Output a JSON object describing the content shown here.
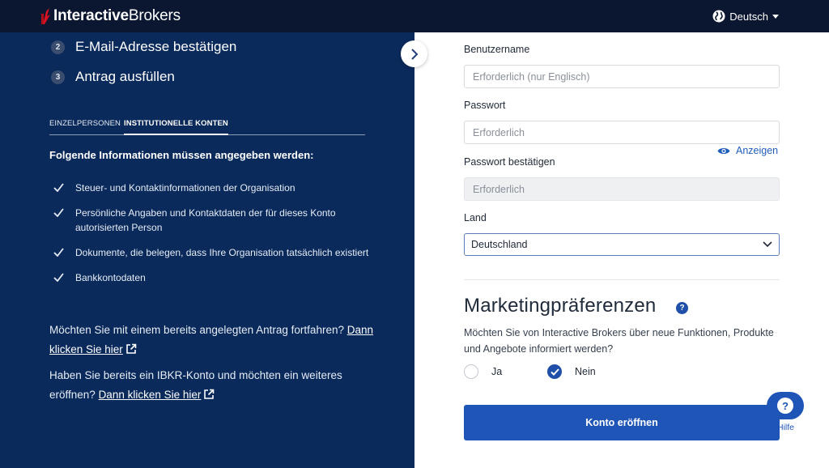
{
  "header": {
    "brand_bold": "Interactive",
    "brand_light": "Brokers",
    "language": "Deutsch"
  },
  "steps": [
    {
      "num": "2",
      "label": "E-Mail-Adresse bestätigen"
    },
    {
      "num": "3",
      "label": "Antrag ausfüllen"
    }
  ],
  "tabs": [
    {
      "label": "EINZELPERSONEN",
      "active": false
    },
    {
      "label": "INSTITUTIONELLE KONTEN",
      "active": true
    }
  ],
  "requirements": {
    "title": "Folgende Informationen müssen angegeben werden:",
    "items": [
      "Steuer- und Kontaktinformationen der Organisation",
      "Persönliche Angaben und Kontaktdaten der für dieses Konto autorisierten Person",
      "Dokumente, die belegen, dass Ihre Organisation tatsächlich existiert",
      "Bankkontodaten"
    ]
  },
  "continue_prompt": {
    "text": "Möchten Sie mit einem bereits angelegten Antrag fortfahren? ",
    "link": "Dann klicken Sie hier"
  },
  "existing_prompt": {
    "text": "Haben Sie bereits ein IBKR-Konto und möchten ein weiteres eröffnen? ",
    "link": "Dann klicken Sie hier"
  },
  "form": {
    "username_label": "Benutzername",
    "username_placeholder": "Erforderlich (nur Englisch)",
    "password_label": "Passwort",
    "password_placeholder": "Erforderlich",
    "show_password": "Anzeigen",
    "confirm_label": "Passwort bestätigen",
    "confirm_placeholder": "Erforderlich",
    "country_label": "Land",
    "country_value": "Deutschland"
  },
  "marketing": {
    "title": "Marketingpräferenzen",
    "help": "?",
    "description": "Möchten Sie von Interactive Brokers über neue Funktionen, Produkte und Angebote informiert werden?",
    "options": [
      {
        "label": "Ja",
        "selected": false
      },
      {
        "label": "Nein",
        "selected": true
      }
    ]
  },
  "submit_label": "Konto eröffnen",
  "help_widget": {
    "symbol": "?",
    "label": "Hilfe"
  },
  "colors": {
    "topbar": "#0b1730",
    "panel": "#0a2a5c",
    "accent": "#1f55b6",
    "logo_red": "#d81222"
  }
}
